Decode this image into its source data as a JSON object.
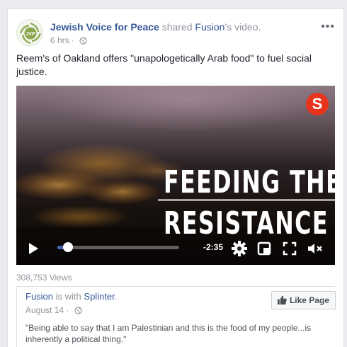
{
  "post": {
    "page_name": "Jewish Voice for Peace",
    "shared_text": "shared",
    "shared_source": "Fusion",
    "shared_suffix": "'s video.",
    "timestamp": "6 hrs",
    "separator": "·",
    "avatar_text": "JVP",
    "menu_label": "•••",
    "body_text": "Reem's of Oakland offers \"unapologetically Arab food\" to fuel social justice."
  },
  "video": {
    "title_line1": "FEEDING THE",
    "title_line2": "RESISTANCE",
    "badge_letter": "S",
    "time_remaining": "-2:35",
    "progress": 0.09,
    "icons": [
      "play-icon",
      "settings-gear-icon",
      "embed-square-icon",
      "fullscreen-icon",
      "volume-muted-icon"
    ]
  },
  "views": "308,753 Views",
  "shared_video": {
    "author": "Fusion",
    "with_text": "is with",
    "tagged": "Splinter",
    "date": "August 14",
    "separator": "·",
    "like_button_label": "Like Page",
    "quote": "\"Being able to say that I am Palestinian and this is the food of my people...is inherently a political thing.\""
  },
  "colors": {
    "link": "#365899",
    "meta": "#90949c",
    "progress": "#4267b2",
    "badge": "#e8341c",
    "avatar_green": "#8aa64a"
  }
}
